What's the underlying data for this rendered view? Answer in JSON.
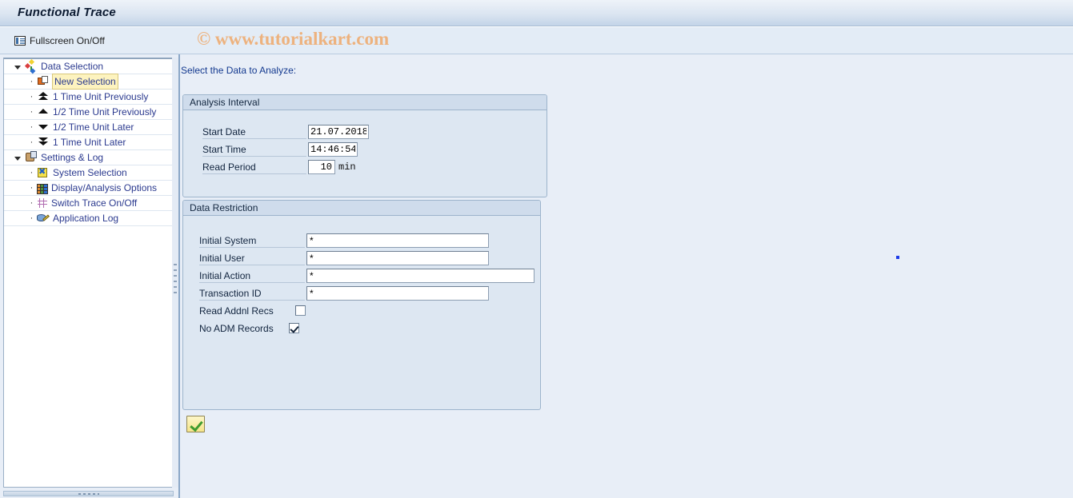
{
  "window": {
    "title": "Functional Trace"
  },
  "toolbar": {
    "fullscreen_label": "Fullscreen On/Off",
    "fullscreen_icon": "fullscreen-toggle-icon"
  },
  "watermark": {
    "text": "© www.tutorialkart.com",
    "color": "#edb27e"
  },
  "tree": {
    "nodes": [
      {
        "label": "Data Selection",
        "level": 0,
        "icon": "data-selection-icon",
        "selected": false,
        "expanded": true
      },
      {
        "label": "New Selection",
        "level": 1,
        "icon": "new-selection-icon",
        "selected": true
      },
      {
        "label": "1 Time Unit Previously",
        "level": 1,
        "icon": "double-up-arrow-icon",
        "selected": false
      },
      {
        "label": "1/2 Time Unit Previously",
        "level": 1,
        "icon": "up-arrow-icon",
        "selected": false
      },
      {
        "label": "1/2 Time Unit Later",
        "level": 1,
        "icon": "down-arrow-icon",
        "selected": false
      },
      {
        "label": "1 Time Unit Later",
        "level": 1,
        "icon": "double-down-arrow-icon",
        "selected": false
      },
      {
        "label": "Settings & Log",
        "level": 0,
        "icon": "settings-log-icon",
        "selected": false,
        "expanded": true
      },
      {
        "label": "System Selection",
        "level": 1,
        "icon": "system-selection-icon",
        "selected": false
      },
      {
        "label": "Display/Analysis Options",
        "level": 1,
        "icon": "grid-options-icon",
        "selected": false
      },
      {
        "label": "Switch Trace On/Off",
        "level": 1,
        "icon": "trace-switch-icon",
        "selected": false
      },
      {
        "label": "Application Log",
        "level": 1,
        "icon": "application-log-icon",
        "selected": false
      }
    ]
  },
  "content": {
    "heading": "Select the Data to Analyze:",
    "analysis_interval": {
      "title": "Analysis Interval",
      "start_date_label": "Start Date",
      "start_date_value": "21.07.2018",
      "start_time_label": "Start Time",
      "start_time_value": "14:46:54",
      "read_period_label": "Read Period",
      "read_period_value": "10",
      "read_period_unit": "min"
    },
    "data_restriction": {
      "title": "Data Restriction",
      "initial_system_label": "Initial System",
      "initial_system_value": "*",
      "initial_user_label": "Initial User",
      "initial_user_value": "*",
      "initial_action_label": "Initial Action",
      "initial_action_value": "*",
      "transaction_id_label": "Transaction ID",
      "transaction_id_value": "*",
      "read_addnl_recs_label": "Read Addnl Recs",
      "read_addnl_recs_checked": false,
      "no_adm_records_label": "No ADM Records",
      "no_adm_records_checked": true
    },
    "ok_button": {
      "icon": "green-check-icon",
      "tooltip": "Execute"
    }
  }
}
